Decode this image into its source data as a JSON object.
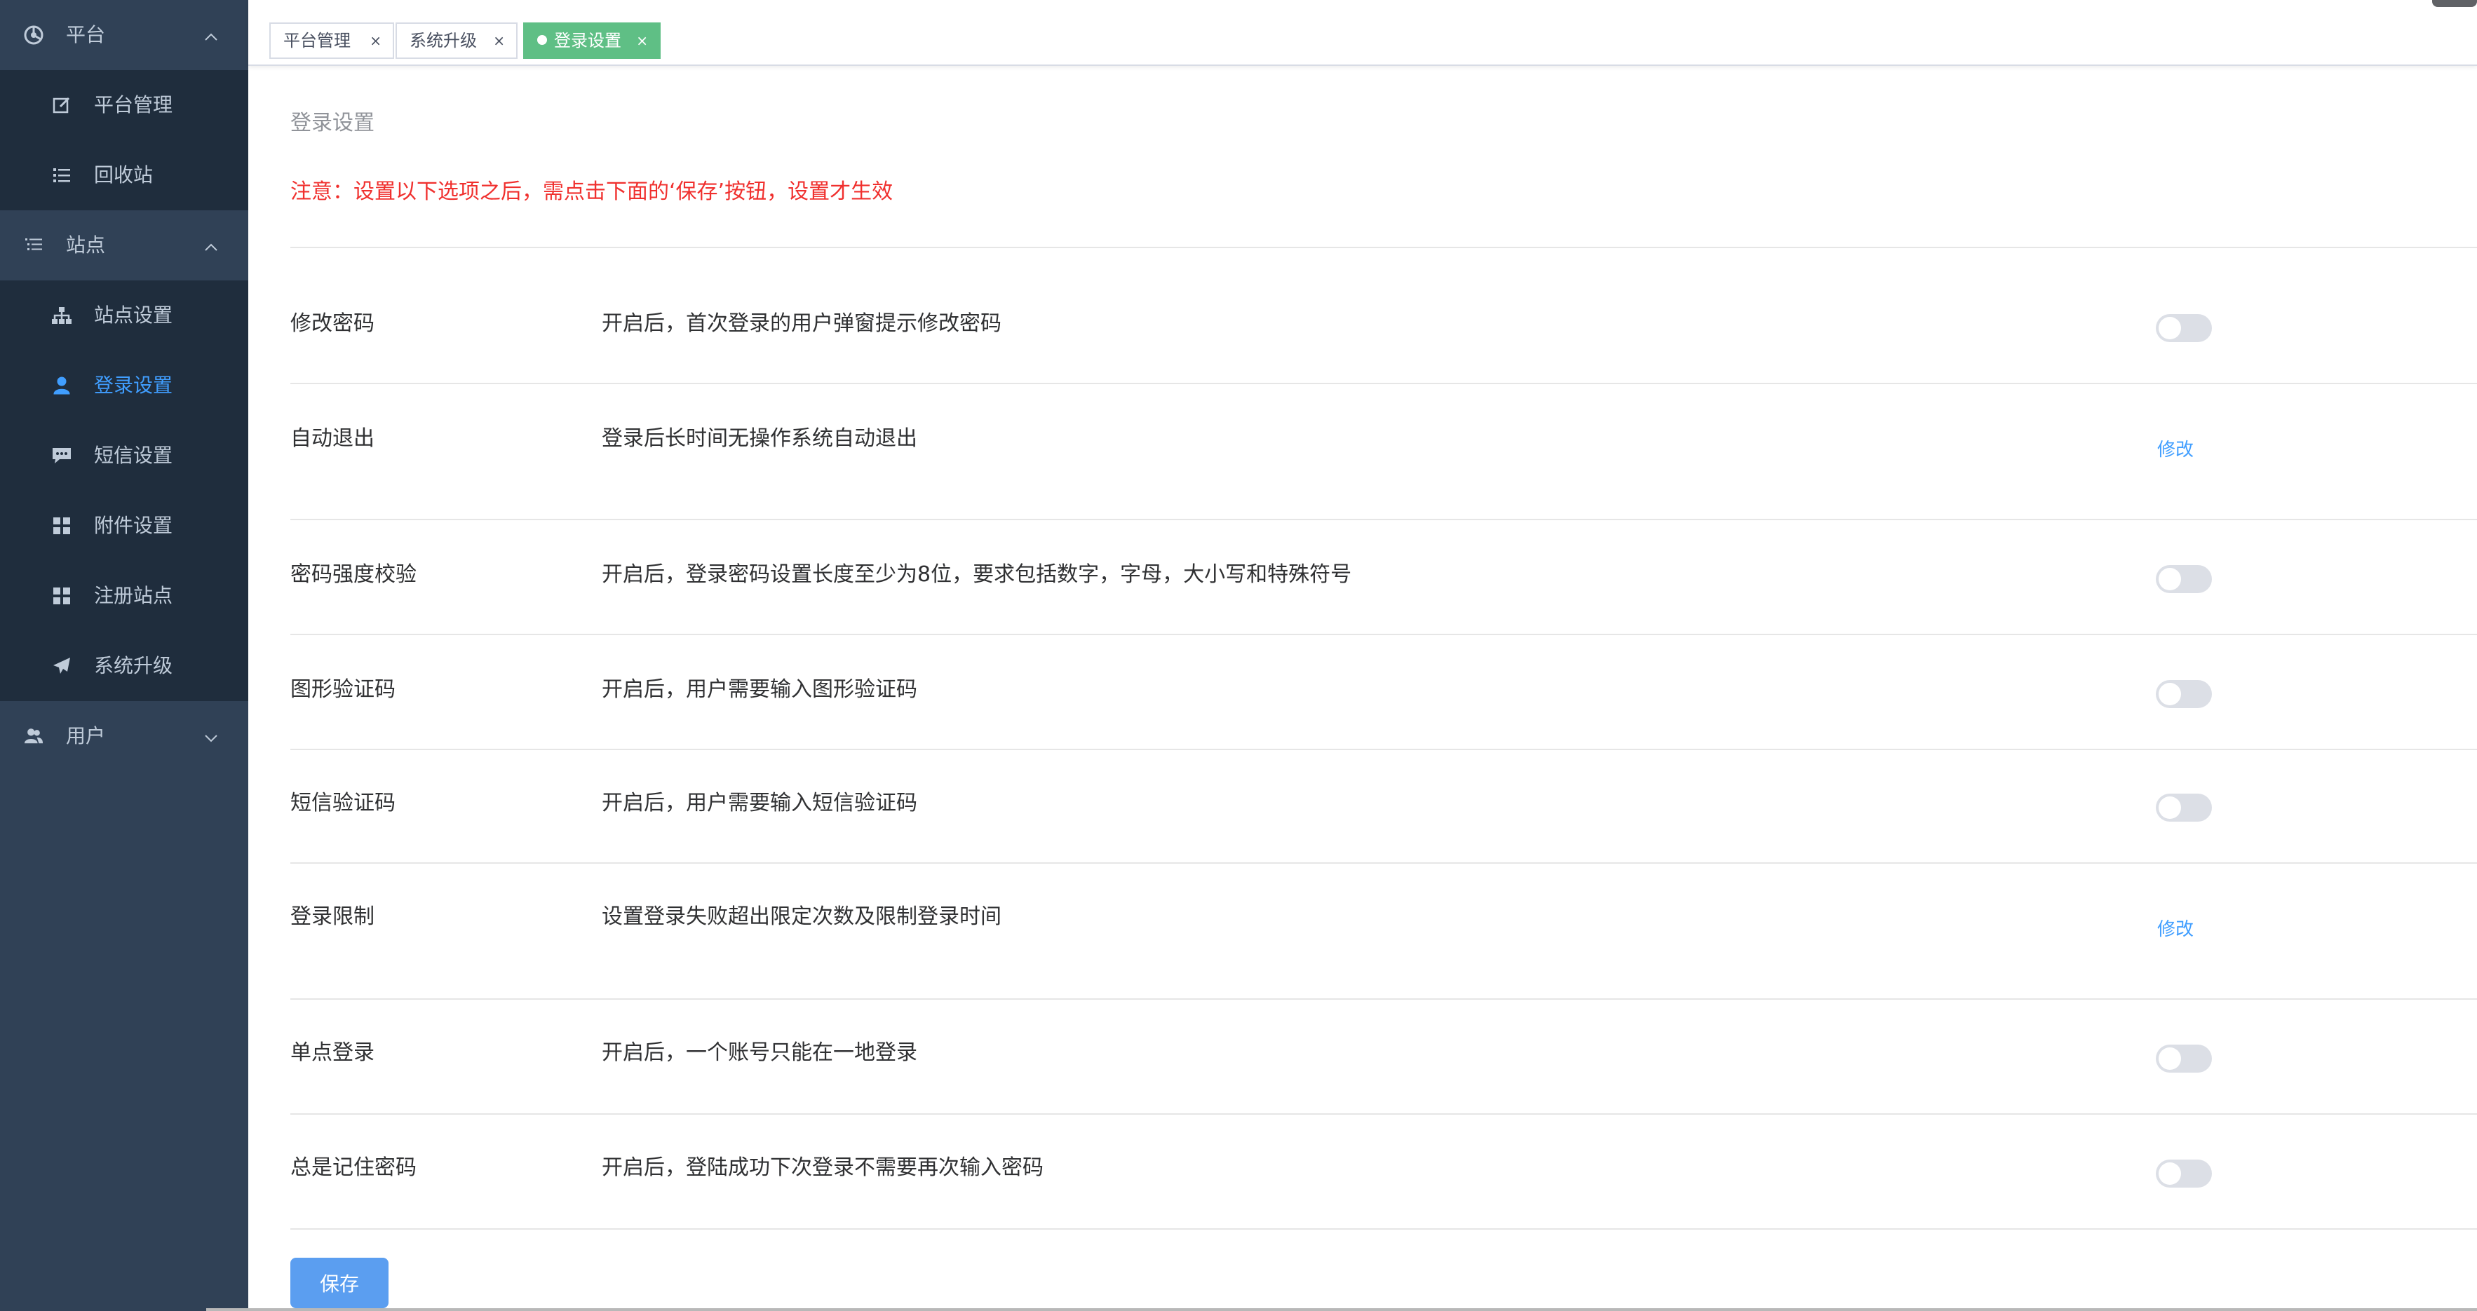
{
  "sidebar": {
    "groups": [
      {
        "label": "平台",
        "icon": "platform-icon",
        "expanded": true,
        "items": [
          {
            "label": "平台管理",
            "icon": "edit-icon"
          },
          {
            "label": "回收站",
            "icon": "list-icon"
          }
        ]
      },
      {
        "label": "站点",
        "icon": "site-list-icon",
        "expanded": true,
        "items": [
          {
            "label": "站点设置",
            "icon": "sitemap-icon"
          },
          {
            "label": "登录设置",
            "icon": "user-icon",
            "active": true
          },
          {
            "label": "短信设置",
            "icon": "message-icon"
          },
          {
            "label": "附件设置",
            "icon": "grid-icon"
          },
          {
            "label": "注册站点",
            "icon": "grid-icon"
          },
          {
            "label": "系统升级",
            "icon": "paper-plane-icon"
          }
        ]
      },
      {
        "label": "用户",
        "icon": "users-icon",
        "expanded": false
      }
    ]
  },
  "tabs": [
    {
      "label": "平台管理",
      "active": false
    },
    {
      "label": "系统升级",
      "active": false
    },
    {
      "label": "登录设置",
      "active": true
    }
  ],
  "tab_close_glyph": "×",
  "page": {
    "title": "登录设置",
    "notice": "注意：设置以下选项之后，需点击下面的‘保存’按钮，设置才生效",
    "edit_label": "修改",
    "save_label": "保存"
  },
  "settings": [
    {
      "name": "修改密码",
      "desc": "开启后，首次登录的用户弹窗提示修改密码",
      "control": "switch",
      "on": false
    },
    {
      "name": "自动退出",
      "desc": "登录后长时间无操作系统自动退出",
      "control": "edit"
    },
    {
      "name": "密码强度校验",
      "desc": "开启后，登录密码设置长度至少为8位，要求包括数字，字母，大小写和特殊符号",
      "control": "switch",
      "on": false
    },
    {
      "name": "图形验证码",
      "desc": "开启后，用户需要输入图形验证码",
      "control": "switch",
      "on": false
    },
    {
      "name": "短信验证码",
      "desc": "开启后，用户需要输入短信验证码",
      "control": "switch",
      "on": false
    },
    {
      "name": "登录限制",
      "desc": "设置登录失败超出限定次数及限制登录时间",
      "control": "edit"
    },
    {
      "name": "单点登录",
      "desc": "开启后，一个账号只能在一地登录",
      "control": "switch",
      "on": false
    },
    {
      "name": "总是记住密码",
      "desc": "开启后，登陆成功下次登录不需要再次输入密码",
      "control": "switch",
      "on": false
    }
  ],
  "colors": {
    "sidebar_bg": "#304156",
    "submenu_bg": "#1f2d3d",
    "active_text": "#409eff",
    "active_tag": "#5fbf85",
    "notice_red": "#f0302e",
    "save_button": "#5b9ef0"
  }
}
